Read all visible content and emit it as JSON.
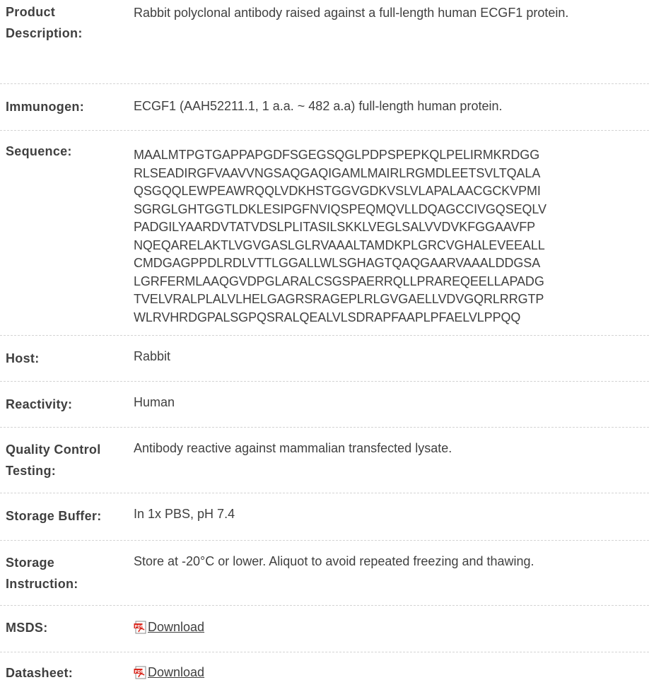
{
  "rows": [
    {
      "label": "Product Description:",
      "value": "Rabbit polyclonal antibody raised against a full-length human ECGF1 protein."
    },
    {
      "label": "Immunogen:",
      "value": "ECGF1 (AAH52211.1, 1 a.a. ~ 482 a.a) full-length human protein."
    },
    {
      "label": "Sequence:",
      "sequence_lines": [
        "MAALMTPGTGAPPAPGDFSGEGSQGLPDPSPEPKQLPELIRMKRDGG",
        "RLSEADIRGFVAAVVNGSAQGAQIGAMLMAIRLRGMDLEETSVLTQALA",
        "QSGQQLEWPEAWRQQLVDKHSTGGVGDKVSLVLAPALAACGCKVPMI",
        "SGRGLGHTGGTLDKLESIPGFNVIQSPEQMQVLLDQAGCCIVGQSEQLV",
        "PADGILYAARDVTATVDSLPLITASILSKKLVEGLSALVVDVKFGGAAVFP",
        "NQEQARELAKTLVGVGASLGLRVAAALTAMDKPLGRCVGHALEVEEALL",
        "CMDGAGPPDLRDLVTTLGGALLWLSGHAGTQAQGAARVAAALDDGSA",
        "LGRFERMLAAQGVDPGLARALCSGSPAERRQLLPRAREQEELLAPADG",
        "TVELVRALPLALVLHELGAGRSRAGEPLRLGVGAELLVDVGQRLRRGTP",
        "WLRVHRDGPALSGPQSRALQEALVLSDRAPFAAPLPFAELVLPPQQ"
      ]
    },
    {
      "label": "Host:",
      "value": "Rabbit"
    },
    {
      "label": "Reactivity:",
      "value": "Human"
    },
    {
      "label": "Quality Control Testing:",
      "value": "Antibody reactive against mammalian transfected lysate."
    },
    {
      "label": "Storage Buffer:",
      "value": "In 1x PBS, pH 7.4"
    },
    {
      "label": "Storage Instruction:",
      "value": "Store at -20°C or lower. Aliquot to avoid repeated freezing and thawing."
    },
    {
      "label": "MSDS:",
      "link": "Download",
      "icon": "pdf-icon"
    },
    {
      "label": "Datasheet:",
      "link": "Download",
      "icon": "pdf-icon"
    }
  ],
  "colors": {
    "text": "#404040",
    "divider": "#d4d4d4",
    "pdf_red": "#d9261c"
  }
}
